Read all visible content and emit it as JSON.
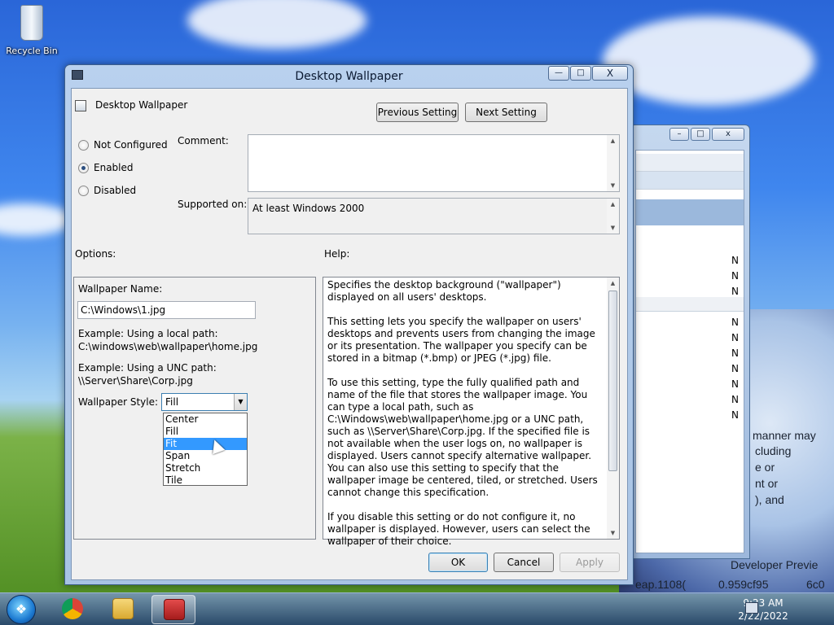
{
  "desktop": {
    "icons": [
      {
        "label": "Recycle Bin",
        "icon": "recycle-bin-icon"
      }
    ],
    "bg_text": [
      "manner may",
      "cluding",
      "e or",
      "nt or",
      "), and",
      "Developer Previe",
      "eap.1108(",
      "0.959cf95",
      "6c0"
    ]
  },
  "back_window": {
    "minimize": "–",
    "maximize": "□",
    "close": "x",
    "column_values": [
      "N",
      "N",
      "N",
      "N",
      "N",
      "N",
      "N",
      "N",
      "N",
      "N"
    ]
  },
  "dialog": {
    "title": "Desktop Wallpaper",
    "window_controls": {
      "minimize": "—",
      "maximize": "□",
      "close": "X"
    },
    "setting_icon": "policy-setting-icon",
    "setting_name": "Desktop Wallpaper",
    "prev_button": "Previous Setting",
    "next_button": "Next Setting",
    "state_options": [
      {
        "label": "Not Configured",
        "checked": false
      },
      {
        "label": "Enabled",
        "checked": true
      },
      {
        "label": "Disabled",
        "checked": false
      }
    ],
    "comment_label": "Comment:",
    "comment_value": "",
    "supported_label": "Supported on:",
    "supported_value": "At least Windows 2000",
    "options_label": "Options:",
    "help_label": "Help:",
    "options": {
      "wallpaper_name_label": "Wallpaper Name:",
      "wallpaper_name_value": "C:\\Windows\\1.jpg",
      "example_local_1": "Example: Using a local path:",
      "example_local_2": "C:\\windows\\web\\wallpaper\\home.jpg",
      "example_unc_1": "Example: Using a UNC path:",
      "example_unc_2": "\\\\Server\\Share\\Corp.jpg",
      "style_label": "Wallpaper Style:",
      "style_value": "Fill",
      "style_options": [
        "Center",
        "Fill",
        "Fit",
        "Span",
        "Stretch",
        "Tile"
      ],
      "style_highlighted": "Fit"
    },
    "help_paragraphs": [
      "Specifies the desktop background (\"wallpaper\") displayed on all users' desktops.",
      "This setting lets you specify the wallpaper on users' desktops and prevents users from changing the image or its presentation. The wallpaper you specify can be stored in a bitmap (*.bmp) or JPEG (*.jpg) file.",
      "To use this setting, type the fully qualified path and name of the file that stores the wallpaper image. You can type a local path, such as C:\\Windows\\web\\wallpaper\\home.jpg or a UNC path, such as \\\\Server\\Share\\Corp.jpg. If the specified file is not available when the user logs on, no wallpaper is displayed. Users cannot specify alternative wallpaper. You can also use this setting to specify that the wallpaper image be centered, tiled, or stretched. Users cannot change this specification.",
      "If you disable this setting or do not configure it, no wallpaper is displayed. However, users can select the wallpaper of their choice."
    ],
    "ok": "OK",
    "cancel": "Cancel",
    "apply": "Apply"
  },
  "taskbar": {
    "start_label": "Start",
    "apps": [
      {
        "name": "chrome",
        "icon": "chrome-icon",
        "active": false
      },
      {
        "name": "file-explorer",
        "icon": "folder-icon",
        "active": false
      },
      {
        "name": "group-policy-editor",
        "icon": "toolbox-icon",
        "active": true
      }
    ],
    "time": "9:23 AM",
    "date": "2/22/2022"
  },
  "colors": {
    "accent": "#3399ff",
    "taskbar": "#3c5f8a",
    "window_frame": "#b9d1ee"
  }
}
